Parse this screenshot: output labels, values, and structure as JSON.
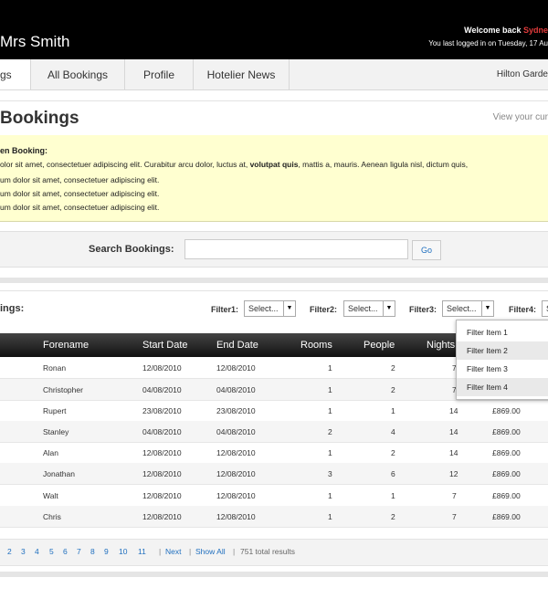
{
  "header": {
    "brand": "Mrs Smith",
    "welcome": "Welcome back ",
    "username": "Sydne",
    "last_login": "You last logged in on Tuesday, 17 Au"
  },
  "nav": {
    "tabs": [
      {
        "label": "gs"
      },
      {
        "label": "All Bookings"
      },
      {
        "label": "Profile"
      },
      {
        "label": "Hotelier News"
      }
    ],
    "hotel": "Hilton Garde"
  },
  "page": {
    "title": "Bookings",
    "view_current": "View your cur"
  },
  "notice": {
    "title": "en Booking:",
    "line1_a": "olor sit amet, consectetuer adipiscing elit. Curabitur arcu dolor, luctus at, ",
    "line1_bold": "volutpat quis",
    "line1_b": ", mattis a, mauris. Aenean ligula nisl, dictum quis,",
    "line2": "um dolor sit amet, consectetuer adipiscing elit.",
    "line3": "um dolor sit amet, consectetuer adipiscing elit.",
    "line4": "um dolor sit amet, consectetuer adipiscing elit."
  },
  "search": {
    "label": "Search Bookings:",
    "value": "",
    "placeholder": "",
    "go": "Go"
  },
  "table_header": {
    "title": "ings:",
    "filters": [
      {
        "label": "Filter1:",
        "value": "Select..."
      },
      {
        "label": "Filter2:",
        "value": "Select..."
      },
      {
        "label": "Filter3:",
        "value": "Select..."
      },
      {
        "label": "Filter4:",
        "value": "S"
      }
    ]
  },
  "table": {
    "columns": [
      "Forename",
      "Start Date",
      "End Date",
      "Rooms",
      "People",
      "Nights"
    ],
    "rows": [
      {
        "forename": "Ronan",
        "start": "12/08/2010",
        "end": "12/08/2010",
        "rooms": "1",
        "people": "2",
        "nights": "7",
        "price": ""
      },
      {
        "forename": "Christopher",
        "start": "04/08/2010",
        "end": "04/08/2010",
        "rooms": "1",
        "people": "2",
        "nights": "7",
        "price": ""
      },
      {
        "forename": "Rupert",
        "start": "23/08/2010",
        "end": "23/08/2010",
        "rooms": "1",
        "people": "1",
        "nights": "14",
        "price": "£869.00"
      },
      {
        "forename": "Stanley",
        "start": "04/08/2010",
        "end": "04/08/2010",
        "rooms": "2",
        "people": "4",
        "nights": "14",
        "price": "£869.00"
      },
      {
        "forename": "Alan",
        "start": "12/08/2010",
        "end": "12/08/2010",
        "rooms": "1",
        "people": "2",
        "nights": "14",
        "price": "£869.00"
      },
      {
        "forename": "Jonathan",
        "start": "12/08/2010",
        "end": "12/08/2010",
        "rooms": "3",
        "people": "6",
        "nights": "12",
        "price": "£869.00"
      },
      {
        "forename": "Walt",
        "start": "12/08/2010",
        "end": "12/08/2010",
        "rooms": "1",
        "people": "1",
        "nights": "7",
        "price": "£869.00"
      },
      {
        "forename": "Chris",
        "start": "12/08/2010",
        "end": "12/08/2010",
        "rooms": "1",
        "people": "2",
        "nights": "7",
        "price": "£869.00"
      }
    ]
  },
  "dropdown": {
    "items": [
      "Filter Item 1",
      "Filter Item 2",
      "Filter Item 3",
      "Filter Item 4"
    ]
  },
  "pager": {
    "pages": [
      "2",
      "3",
      "4",
      "5",
      "6",
      "7",
      "8",
      "9",
      "10",
      "11"
    ],
    "next": "Next",
    "show_all": "Show All",
    "total": "751 total results"
  }
}
